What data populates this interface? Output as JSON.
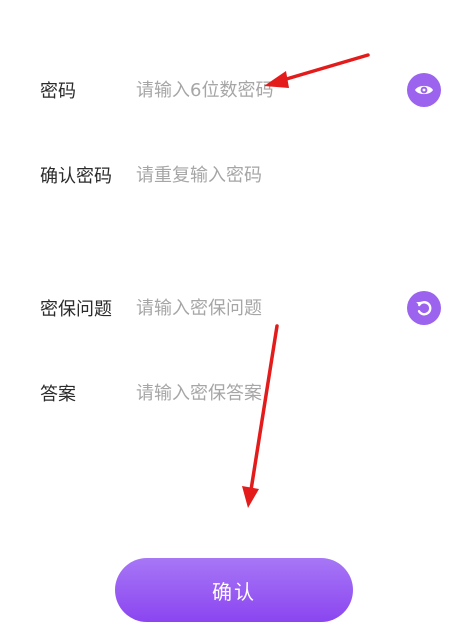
{
  "form": {
    "password": {
      "label": "密码",
      "placeholder": "请输入6位数密码",
      "value": ""
    },
    "confirm_password": {
      "label": "确认密码",
      "placeholder": "请重复输入密码",
      "value": ""
    },
    "security_question": {
      "label": "密保问题",
      "placeholder": "请输入密保问题",
      "value": ""
    },
    "answer": {
      "label": "答案",
      "placeholder": "请输入密保答案",
      "value": ""
    }
  },
  "icons": {
    "password_toggle": "eye-icon",
    "question_refresh": "refresh-icon"
  },
  "confirm_button": {
    "label": "确认"
  },
  "colors": {
    "accent": "#9b63ee",
    "button_top": "#a777f6",
    "button_bottom": "#8b45f0",
    "annotation_arrow": "#e31b1b",
    "placeholder": "#a6a6a6",
    "label": "#2b2b2b"
  }
}
